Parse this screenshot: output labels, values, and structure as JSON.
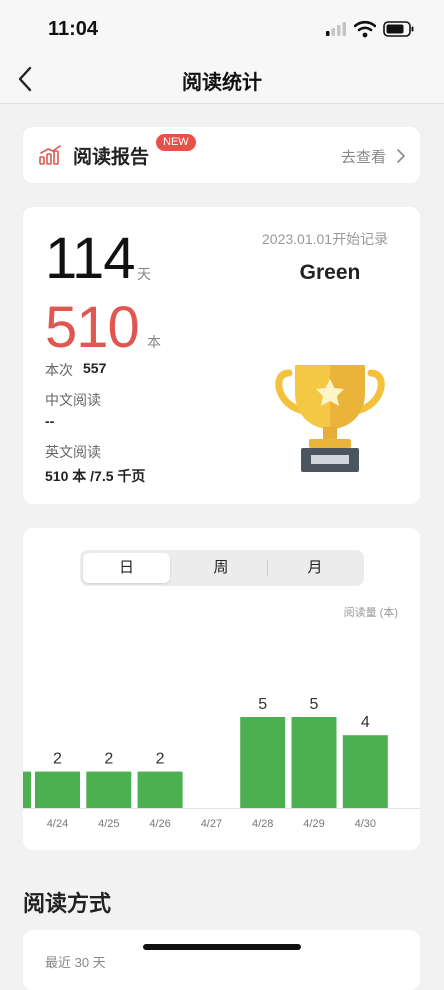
{
  "status_bar": {
    "time": "11:04"
  },
  "nav": {
    "title": "阅读统计"
  },
  "report": {
    "title": "阅读报告",
    "badge": "NEW",
    "link": "去查看"
  },
  "stats": {
    "days": "114",
    "days_unit": "天",
    "books": "510",
    "books_unit": "本",
    "start_date": "2023.01.01开始记录",
    "user_name": "Green",
    "session_label": "本次",
    "session_value": "557",
    "chinese_label": "中文阅读",
    "chinese_value": "--",
    "english_label": "英文阅读",
    "english_value": "510 本 /7.5 千页"
  },
  "period_tabs": {
    "day": "日",
    "week": "周",
    "month": "月",
    "selected": "日"
  },
  "chart_unit_label": "阅读量 (本)",
  "chart_data": {
    "type": "bar",
    "categories": [
      "4/24",
      "4/25",
      "4/26",
      "4/27",
      "4/28",
      "4/29",
      "4/30"
    ],
    "values": [
      2,
      2,
      2,
      0,
      5,
      5,
      4
    ],
    "ylabel": "阅读量 (本)",
    "color": "#4caf50",
    "partial_left_value": 2
  },
  "section": {
    "title": "阅读方式",
    "subtitle": "最近 30 天"
  },
  "colors": {
    "accent_red": "#e0574f",
    "bar_green": "#4caf50",
    "badge_red": "#e8514a"
  }
}
